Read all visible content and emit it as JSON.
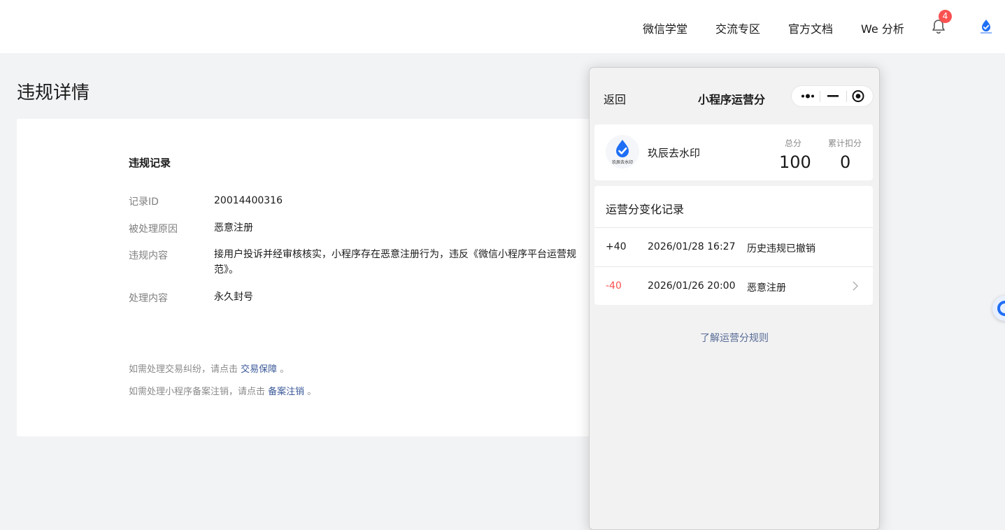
{
  "nav": {
    "links": [
      "微信学堂",
      "交流专区",
      "官方文档",
      "We 分析"
    ],
    "notification_count": "4"
  },
  "page": {
    "title": "违规详情"
  },
  "record": {
    "section_title": "违规记录",
    "rows": [
      {
        "label": "记录ID",
        "value": "20014400316"
      },
      {
        "label": "被处理原因",
        "value": "恶意注册"
      },
      {
        "label": "违规内容",
        "value": "接用户投诉并经审核核实，小程序存在恶意注册行为，违反《微信小程序平台运营规范》。"
      },
      {
        "label": "处理内容",
        "value": "永久封号"
      }
    ],
    "tips": [
      {
        "prefix": "如需处理交易纠纷，请点击 ",
        "link": "交易保障",
        "suffix": " 。"
      },
      {
        "prefix": "如需处理小程序备案注销，请点击 ",
        "link": "备案注销",
        "suffix": " 。"
      }
    ]
  },
  "phone": {
    "back_label": "返回",
    "title": "小程序运营分",
    "app": {
      "name": "玖辰去水印",
      "logo_text": "玖辰去水印",
      "total_label": "总分",
      "total_value": "100",
      "deduct_label": "累计扣分",
      "deduct_value": "0"
    },
    "records_title": "运营分变化记录",
    "records": [
      {
        "delta": "+40",
        "time": "2026/01/28 16:27",
        "desc": "历史违规已撤销",
        "color": "#1a1a1a"
      },
      {
        "delta": "-40",
        "time": "2026/01/26 20:00",
        "desc": "恶意注册",
        "color": "#fa5151"
      }
    ],
    "rules_link": "了解运营分规则"
  },
  "colors": {
    "accent_blue": "#1f6ff5",
    "negative_red": "#fa5151",
    "link_blue": "#576b95"
  }
}
